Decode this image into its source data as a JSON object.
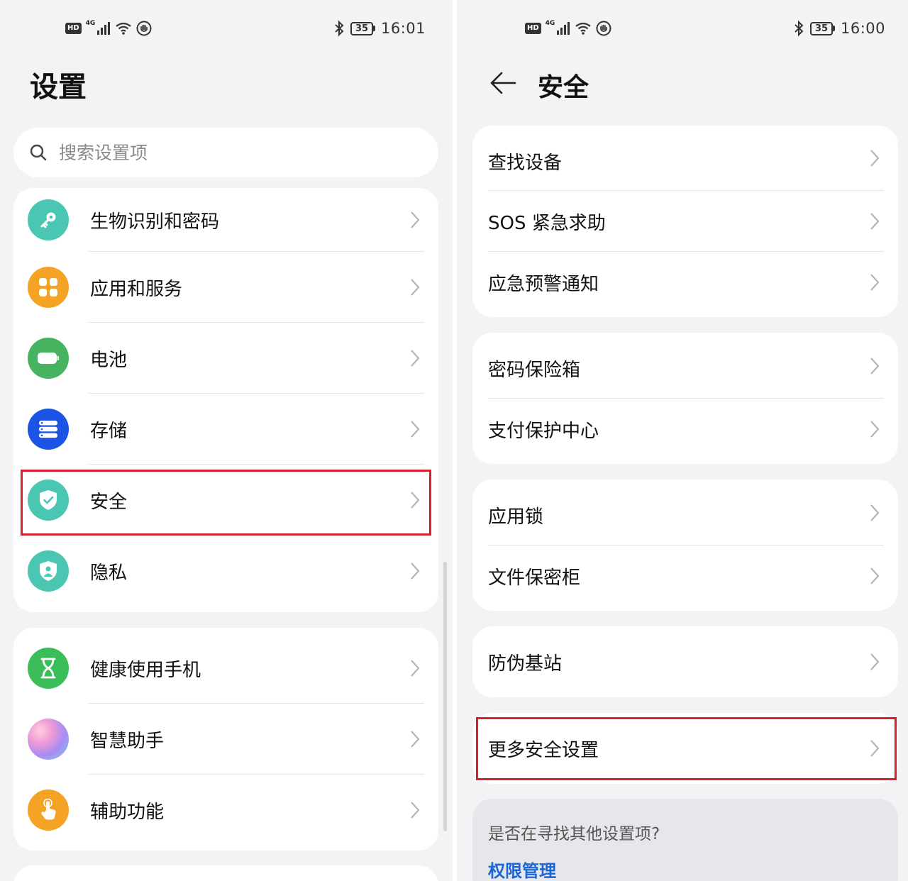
{
  "left": {
    "status": {
      "time": "16:01",
      "battery": "35",
      "hd": "HD",
      "net": "4G"
    },
    "title": "设置",
    "search_placeholder": "搜索设置项",
    "groups": [
      [
        {
          "label": "生物识别和密码",
          "icon": "key-icon",
          "color": "#4ac6b2"
        },
        {
          "label": "应用和服务",
          "icon": "apps-icon",
          "color": "#f5a324"
        },
        {
          "label": "电池",
          "icon": "battery-icon",
          "color": "#45b35f"
        },
        {
          "label": "存储",
          "icon": "storage-icon",
          "color": "#1c55e6"
        },
        {
          "label": "安全",
          "icon": "shield-check-icon",
          "color": "#4ac6b2"
        },
        {
          "label": "隐私",
          "icon": "privacy-shield-icon",
          "color": "#4ac6b2"
        }
      ],
      [
        {
          "label": "健康使用手机",
          "icon": "hourglass-icon",
          "color": "#3bbd5a"
        },
        {
          "label": "智慧助手",
          "icon": "assistant-icon",
          "color": "#b48be8"
        },
        {
          "label": "辅助功能",
          "icon": "hand-icon",
          "color": "#f5a324"
        }
      ]
    ]
  },
  "right": {
    "status": {
      "time": "16:00",
      "battery": "35",
      "hd": "HD",
      "net": "4G"
    },
    "title": "安全",
    "groups": [
      [
        "查找设备",
        "SOS 紧急求助",
        "应急预警通知"
      ],
      [
        "密码保险箱",
        "支付保护中心"
      ],
      [
        "应用锁",
        "文件保密柜"
      ],
      [
        "防伪基站"
      ],
      [
        "更多安全设置"
      ]
    ],
    "hint": {
      "question": "是否在寻找其他设置项?",
      "link": "权限管理"
    }
  },
  "colors": {
    "highlight": "#d4202e",
    "link": "#1a66d6",
    "background": "#f1f3f5"
  }
}
